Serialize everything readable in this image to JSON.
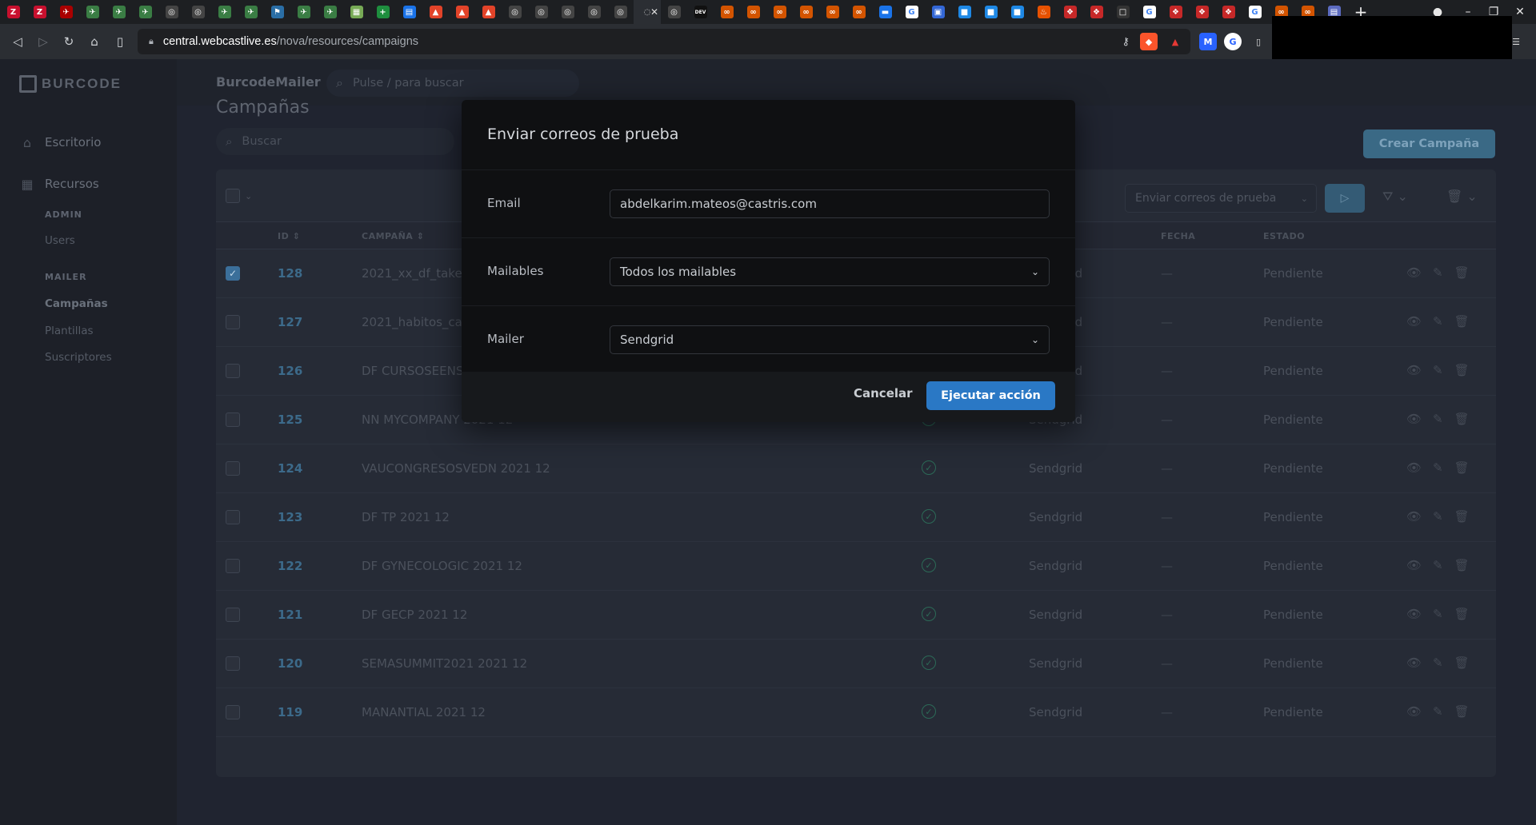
{
  "browser": {
    "tabs": [
      {
        "icon": "zotero-icon",
        "glyph": "Z",
        "bg": "#c8102e"
      },
      {
        "icon": "zotero-icon",
        "glyph": "Z",
        "bg": "#c8102e"
      },
      {
        "icon": "bird-icon",
        "glyph": "✈",
        "bg": "#a00"
      },
      {
        "icon": "bird-icon",
        "glyph": "✈",
        "bg": "#3a7d44"
      },
      {
        "icon": "bird-icon",
        "glyph": "✈",
        "bg": "#3a7d44"
      },
      {
        "icon": "bird-icon",
        "glyph": "✈",
        "bg": "#3a7d44"
      },
      {
        "icon": "globe-icon",
        "glyph": "◎",
        "bg": "#444"
      },
      {
        "icon": "globe-icon",
        "glyph": "◎",
        "bg": "#444"
      },
      {
        "icon": "bird-icon",
        "glyph": "✈",
        "bg": "#3a7d44"
      },
      {
        "icon": "bird-icon",
        "glyph": "✈",
        "bg": "#3a7d44"
      },
      {
        "icon": "pin-icon",
        "glyph": "⚑",
        "bg": "#2a6ea6"
      },
      {
        "icon": "bird-icon",
        "glyph": "✈",
        "bg": "#3a7d44"
      },
      {
        "icon": "bird-icon",
        "glyph": "✈",
        "bg": "#3a7d44"
      },
      {
        "icon": "sheet-icon",
        "glyph": "▦",
        "bg": "#7a5"
      },
      {
        "icon": "plus-square-icon",
        "glyph": "+",
        "bg": "#1e8e3e"
      },
      {
        "icon": "doc-icon",
        "glyph": "▤",
        "bg": "#1a73e8"
      },
      {
        "icon": "gitlab-icon",
        "glyph": "▲",
        "bg": "#e24329"
      },
      {
        "icon": "gitlab-icon",
        "glyph": "▲",
        "bg": "#e24329"
      },
      {
        "icon": "gitlab-icon",
        "glyph": "▲",
        "bg": "#e24329"
      },
      {
        "icon": "globe-icon",
        "glyph": "◎",
        "bg": "#444"
      },
      {
        "icon": "globe-icon",
        "glyph": "◎",
        "bg": "#444"
      },
      {
        "icon": "globe-icon",
        "glyph": "◎",
        "bg": "#444"
      },
      {
        "icon": "globe-icon",
        "glyph": "◎",
        "bg": "#444"
      },
      {
        "icon": "globe-icon",
        "glyph": "◎",
        "bg": "#444"
      }
    ],
    "tabs2": [
      {
        "icon": "globe-icon",
        "glyph": "◎",
        "bg": "#444"
      },
      {
        "icon": "dev-icon",
        "glyph": "DEV",
        "bg": "#111"
      },
      {
        "icon": "link-icon",
        "glyph": "∞",
        "bg": "#d35400"
      },
      {
        "icon": "link-icon",
        "glyph": "∞",
        "bg": "#d35400"
      },
      {
        "icon": "link-icon",
        "glyph": "∞",
        "bg": "#d35400"
      },
      {
        "icon": "link-icon",
        "glyph": "∞",
        "bg": "#d35400"
      },
      {
        "icon": "link-icon",
        "glyph": "∞",
        "bg": "#d35400"
      },
      {
        "icon": "link-icon",
        "glyph": "∞",
        "bg": "#d35400"
      },
      {
        "icon": "monitor-icon",
        "glyph": "▬",
        "bg": "#1a73e8"
      },
      {
        "icon": "google-icon",
        "glyph": "G",
        "bg": "#fff"
      },
      {
        "icon": "translate-icon",
        "glyph": "▣",
        "bg": "#3367d6"
      },
      {
        "icon": "cube-icon",
        "glyph": "■",
        "bg": "#1e88e5"
      },
      {
        "icon": "cube-icon",
        "glyph": "■",
        "bg": "#1e88e5"
      },
      {
        "icon": "cube-icon",
        "glyph": "■",
        "bg": "#1e88e5"
      },
      {
        "icon": "flame-icon",
        "glyph": "♨",
        "bg": "#e65100"
      },
      {
        "icon": "laravel-icon",
        "glyph": "❖",
        "bg": "#c62828"
      },
      {
        "icon": "laravel-icon",
        "glyph": "❖",
        "bg": "#c62828"
      },
      {
        "icon": "lock-icon",
        "glyph": "□",
        "bg": "#333"
      },
      {
        "icon": "google-icon",
        "glyph": "G",
        "bg": "#fff"
      },
      {
        "icon": "laravel-icon",
        "glyph": "❖",
        "bg": "#c62828"
      },
      {
        "icon": "laravel-icon",
        "glyph": "❖",
        "bg": "#c62828"
      },
      {
        "icon": "laravel-icon",
        "glyph": "❖",
        "bg": "#c62828"
      },
      {
        "icon": "google-icon",
        "glyph": "G",
        "bg": "#fff"
      },
      {
        "icon": "link-icon",
        "glyph": "∞",
        "bg": "#d35400"
      },
      {
        "icon": "link-icon",
        "glyph": "∞",
        "bg": "#d35400"
      },
      {
        "icon": "calendar-icon",
        "glyph": "▤",
        "bg": "#5c6bc0"
      }
    ],
    "url_host": "central.webcastlive.es",
    "url_path": "/nova/resources/campaigns"
  },
  "app": {
    "brand": "BURCODE",
    "header_title": "BurcodeMailer",
    "global_search_placeholder": "Pulse / para buscar",
    "sidebar": {
      "dashboard": "Escritorio",
      "resources": "Recursos",
      "admin_head": "ADMIN",
      "users": "Users",
      "mailer_head": "MAILER",
      "campaigns": "Campañas",
      "templates": "Plantillas",
      "subscribers": "Suscriptores"
    },
    "page_title": "Campañas",
    "search_placeholder": "Buscar",
    "create_button": "Crear Campaña",
    "action_select": "Enviar correos de prueba",
    "columns": {
      "id": "ID",
      "campaign": "CAMPAÑA",
      "date": "FECHA",
      "status": "ESTADO"
    },
    "rows": [
      {
        "id": "128",
        "name": "2021_xx_df_takeda",
        "mailer": "Sendgrid",
        "fecha": "—",
        "estado": "Pendiente",
        "checked": true
      },
      {
        "id": "127",
        "name": "2021_habitos_ca",
        "mailer": "Sendgrid",
        "fecha": "—",
        "estado": "Pendiente",
        "checked": false
      },
      {
        "id": "126",
        "name": "DF CURSOSEENSED 2021 12",
        "mailer": "Sendgrid",
        "fecha": "—",
        "estado": "Pendiente",
        "checked": false
      },
      {
        "id": "125",
        "name": "NN MYCOMPANY 2021 12",
        "mailer": "Sendgrid",
        "fecha": "—",
        "estado": "Pendiente",
        "checked": false
      },
      {
        "id": "124",
        "name": "VAUCONGRESOSVEDN 2021 12",
        "mailer": "Sendgrid",
        "fecha": "—",
        "estado": "Pendiente",
        "checked": false
      },
      {
        "id": "123",
        "name": "DF TP 2021 12",
        "mailer": "Sendgrid",
        "fecha": "—",
        "estado": "Pendiente",
        "checked": false
      },
      {
        "id": "122",
        "name": "DF GYNECOLOGIC 2021 12",
        "mailer": "Sendgrid",
        "fecha": "—",
        "estado": "Pendiente",
        "checked": false
      },
      {
        "id": "121",
        "name": "DF GECP 2021 12",
        "mailer": "Sendgrid",
        "fecha": "—",
        "estado": "Pendiente",
        "checked": false
      },
      {
        "id": "120",
        "name": "SEMASUMMIT2021 2021 12",
        "mailer": "Sendgrid",
        "fecha": "—",
        "estado": "Pendiente",
        "checked": false
      },
      {
        "id": "119",
        "name": "MANANTIAL 2021 12",
        "mailer": "Sendgrid",
        "fecha": "—",
        "estado": "Pendiente",
        "checked": false
      }
    ]
  },
  "modal": {
    "title": "Enviar correos de prueba",
    "email_label": "Email",
    "email_value": "abdelkarim.mateos@castris.com",
    "mailables_label": "Mailables",
    "mailables_value": "Todos los mailables",
    "mailer_label": "Mailer",
    "mailer_value": "Sendgrid",
    "cancel": "Cancelar",
    "execute": "Ejecutar acción"
  }
}
